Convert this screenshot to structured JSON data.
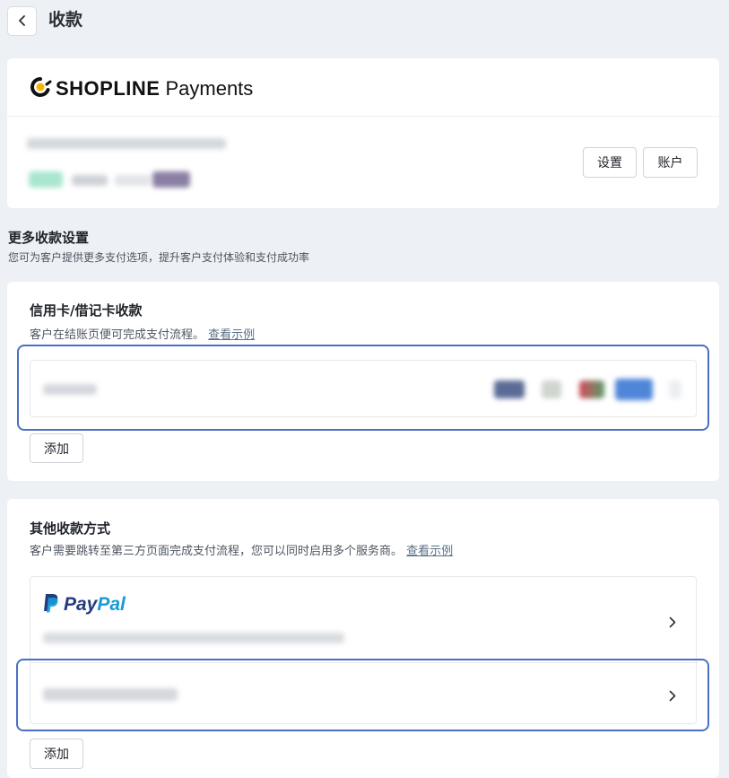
{
  "header": {
    "title": "收款"
  },
  "shopline": {
    "brand_bold": "SHOPLINE",
    "brand_light": "Payments",
    "settings_label": "设置",
    "account_label": "账户"
  },
  "more_settings": {
    "title": "更多收款设置",
    "description": "您可为客户提供更多支付选项，提升客户支付体验和支付成功率"
  },
  "card_payments": {
    "title": "信用卡/借记卡收款",
    "description": "客户在结账页便可完成支付流程。",
    "example_link": "查看示例",
    "add_label": "添加"
  },
  "other_payments": {
    "title": "其他收款方式",
    "description": "客户需要跳转至第三方页面完成支付流程，您可以同时启用多个服务商。",
    "example_link": "查看示例",
    "paypal_brand_1": "Pay",
    "paypal_brand_2": "Pal",
    "add_label": "添加"
  },
  "colors": {
    "highlight": "#4a6fc4",
    "paypal_dark": "#253b80",
    "paypal_light": "#179bd7",
    "shopline_accent": "#f5b400"
  }
}
